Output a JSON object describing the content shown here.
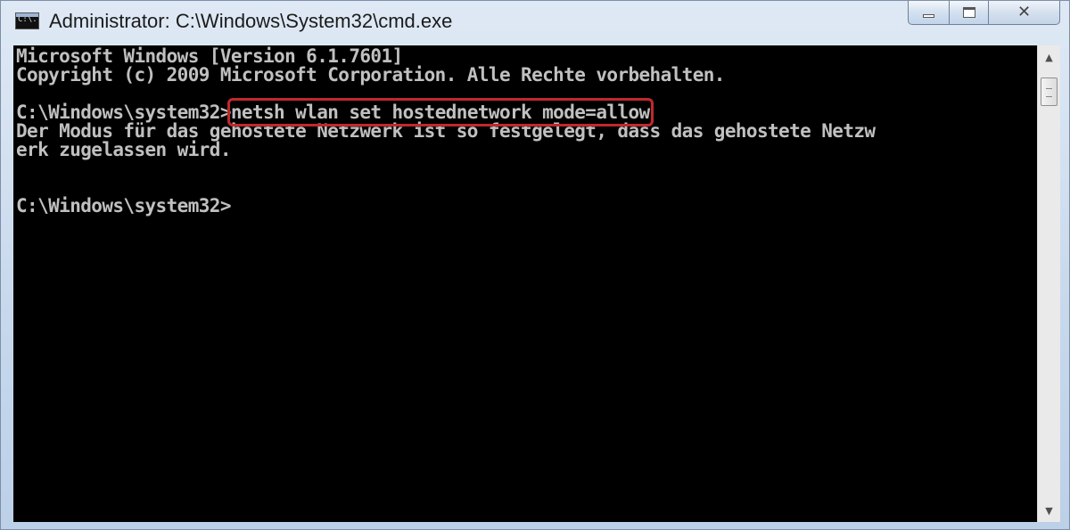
{
  "window": {
    "title": "Administrator: C:\\Windows\\System32\\cmd.exe",
    "app_icon_label": "C:\\.",
    "icons": {
      "app": "cmd-icon",
      "minimize": "minimize-icon",
      "maximize": "maximize-icon",
      "close": "close-icon"
    },
    "close_glyph": "✕"
  },
  "console": {
    "lines": [
      "Microsoft Windows [Version 6.1.7601]",
      "Copyright (c) 2009 Microsoft Corporation. Alle Rechte vorbehalten.",
      "",
      "",
      "Der Modus für das gehostete Netzwerk ist so festgelegt, dass das gehostete Netzw",
      "erk zugelassen wird.",
      "",
      "",
      "C:\\Windows\\system32>"
    ],
    "prompt": "C:\\Windows\\system32>",
    "highlighted_command": "netsh wlan set hostednetwork mode=allow",
    "colors": {
      "background": "#000000",
      "text": "#c0c0c0",
      "highlight_border": "#c0282e"
    }
  },
  "scrollbar": {
    "up_arrow": "▲",
    "down_arrow": "▼"
  }
}
